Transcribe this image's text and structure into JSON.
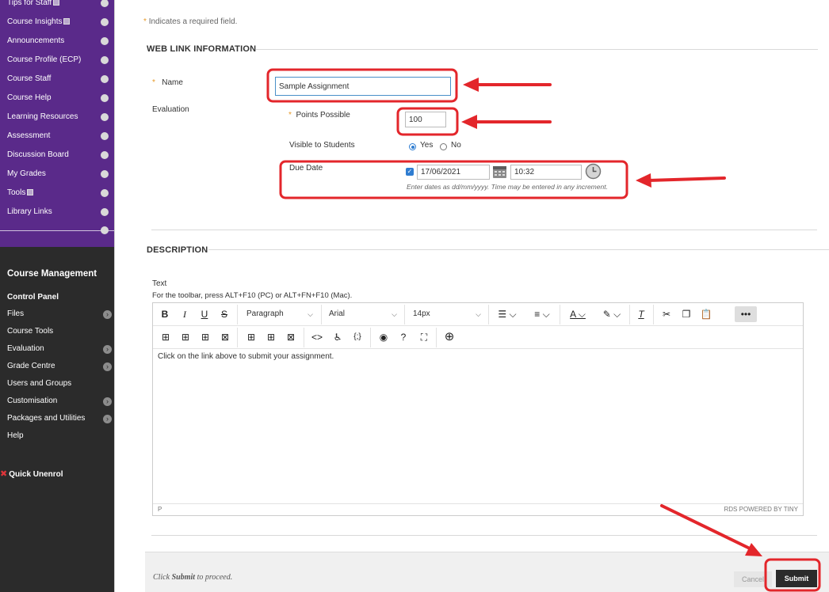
{
  "course_menu": {
    "items": [
      {
        "label": "Tips for Staff",
        "external": true
      },
      {
        "label": "Course Insights",
        "external": true
      },
      {
        "label": "Announcements",
        "external": false
      },
      {
        "label": "Course Profile (ECP)",
        "external": false
      },
      {
        "label": "Course Staff",
        "external": false
      },
      {
        "label": "Course Help",
        "external": false
      },
      {
        "label": "Learning Resources",
        "external": false
      },
      {
        "label": "Assessment",
        "external": false
      },
      {
        "label": "Discussion Board",
        "external": false
      },
      {
        "label": "My Grades",
        "external": false
      },
      {
        "label": "Tools",
        "external": true
      },
      {
        "label": "Library Links",
        "external": false
      }
    ]
  },
  "course_management": {
    "title": "Course Management",
    "control_panel": "Control Panel",
    "items": [
      {
        "label": "Files",
        "has_arrow": true
      },
      {
        "label": "Course Tools",
        "has_arrow": false
      },
      {
        "label": "Evaluation",
        "has_arrow": true
      },
      {
        "label": "Grade Centre",
        "has_arrow": true
      },
      {
        "label": "Users and Groups",
        "has_arrow": false
      },
      {
        "label": "Customisation",
        "has_arrow": true
      },
      {
        "label": "Packages and Utilities",
        "has_arrow": true
      },
      {
        "label": "Help",
        "has_arrow": false
      }
    ],
    "quick_unenrol": "Quick Unenrol"
  },
  "form": {
    "required_marker": "*",
    "required_note": "Indicates a required field.",
    "web_link_section": "WEB LINK INFORMATION",
    "name_label": "Name",
    "name_value": "Sample Assignment",
    "evaluation_label": "Evaluation",
    "points_label": "Points Possible",
    "points_value": "100",
    "visible_label": "Visible to Students",
    "visible_yes": "Yes",
    "visible_no": "No",
    "visible_selected": "Yes",
    "due_date_label": "Due Date",
    "due_date_checked": true,
    "due_date_value": "17/06/2021",
    "due_time_value": "10:32",
    "date_hint": "Enter dates as dd/mm/yyyy. Time may be entered in any increment.",
    "description_section": "DESCRIPTION",
    "text_label": "Text",
    "toolbar_hint": "For the toolbar, press ALT+F10 (PC) or ALT+FN+F10 (Mac)."
  },
  "editor": {
    "block_format": "Paragraph",
    "font_family": "Arial",
    "font_size": "14px",
    "content": "Click on the link above to submit your assignment.",
    "status_path": "P",
    "status_right": "RDS  POWERED BY TINY"
  },
  "footer": {
    "prefix": "Click ",
    "emphasis": "Submit",
    "suffix": " to proceed.",
    "cancel_label": "Cancel",
    "submit_label": "Submit"
  },
  "colors": {
    "course_menu_bg": "#5a2a8a",
    "sidebar_bg": "#2b2b2b",
    "highlight": "#e3262b",
    "accent": "#2f7dd1",
    "submit_bg": "#2b2b2b"
  },
  "icons": [
    "calendar-icon",
    "clock-icon",
    "bold-icon",
    "italic-icon",
    "underline-icon",
    "strikethrough-icon",
    "bullet-list-icon",
    "numbered-list-icon",
    "text-color-icon",
    "highlight-icon",
    "clear-format-icon",
    "cut-icon",
    "copy-icon",
    "paste-icon",
    "more-icon",
    "code-icon",
    "accessibility-icon",
    "source-icon",
    "preview-icon",
    "help-icon",
    "fullscreen-icon",
    "add-icon"
  ]
}
